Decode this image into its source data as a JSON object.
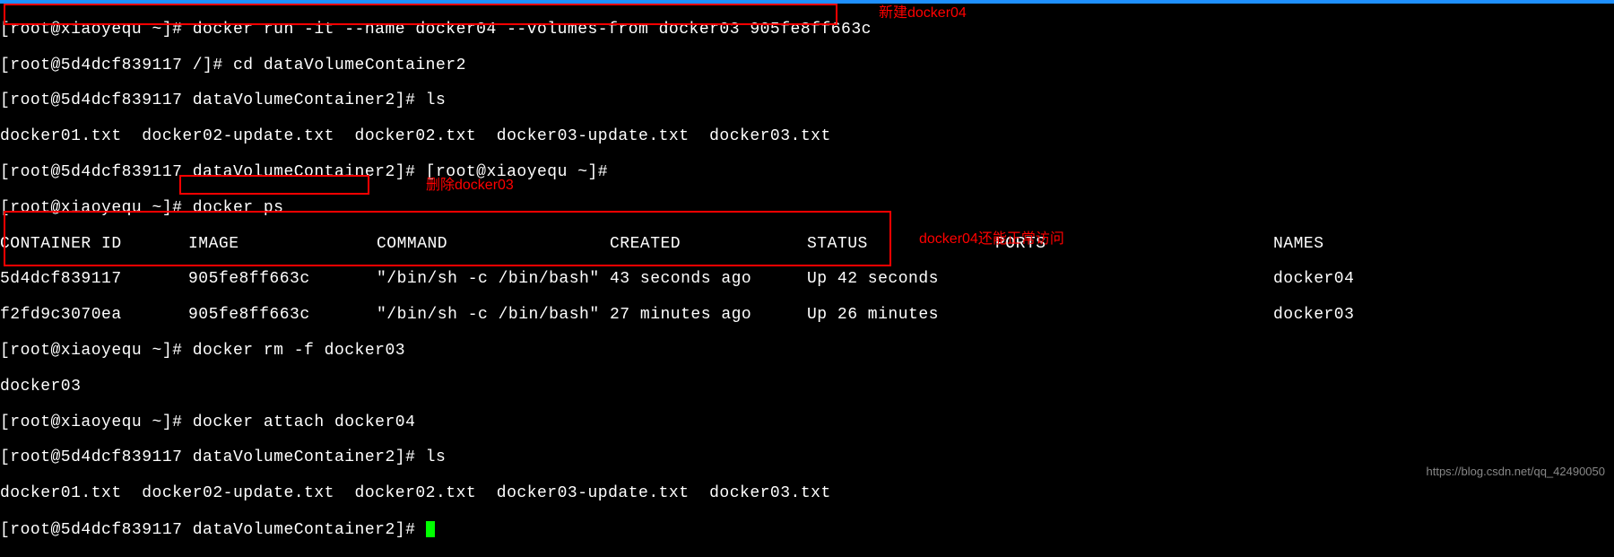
{
  "lines": {
    "l1": "[root@xiaoyequ ~]# docker run -it --name docker04 --volumes-from docker03 905fe8ff663c",
    "l2": "[root@5d4dcf839117 /]# cd dataVolumeContainer2",
    "l3": "[root@5d4dcf839117 dataVolumeContainer2]# ls",
    "l4": "docker01.txt  docker02-update.txt  docker02.txt  docker03-update.txt  docker03.txt",
    "l5": "[root@5d4dcf839117 dataVolumeContainer2]# [root@xiaoyequ ~]#",
    "l6": "[root@xiaoyequ ~]# docker ps",
    "l11": "[root@xiaoyequ ~]# docker rm -f docker03",
    "l12": "docker03",
    "l13": "[root@xiaoyequ ~]# docker attach docker04",
    "l14": "[root@5d4dcf839117 dataVolumeContainer2]# ls",
    "l15": "docker01.txt  docker02-update.txt  docker02.txt  docker03-update.txt  docker03.txt",
    "l16": "[root@5d4dcf839117 dataVolumeContainer2]# "
  },
  "table": {
    "headers": {
      "id": "CONTAINER ID",
      "image": "IMAGE",
      "command": "COMMAND",
      "created": "CREATED",
      "status": "STATUS",
      "ports": "PORTS",
      "names": "NAMES"
    },
    "rows": [
      {
        "id": "5d4dcf839117",
        "image": "905fe8ff663c",
        "command": "\"/bin/sh -c /bin/bash\"",
        "created": "43 seconds ago",
        "status": "Up 42 seconds",
        "ports": "",
        "names": "docker04"
      },
      {
        "id": "f2fd9c3070ea",
        "image": "905fe8ff663c",
        "command": "\"/bin/sh -c /bin/bash\"",
        "created": "27 minutes ago",
        "status": "Up 26 minutes",
        "ports": "",
        "names": "docker03"
      }
    ]
  },
  "annotations": {
    "a1": "新建docker04",
    "a2": "删除docker03",
    "a3": "docker04还能正常访问"
  },
  "watermark": "https://blog.csdn.net/qq_42490050"
}
